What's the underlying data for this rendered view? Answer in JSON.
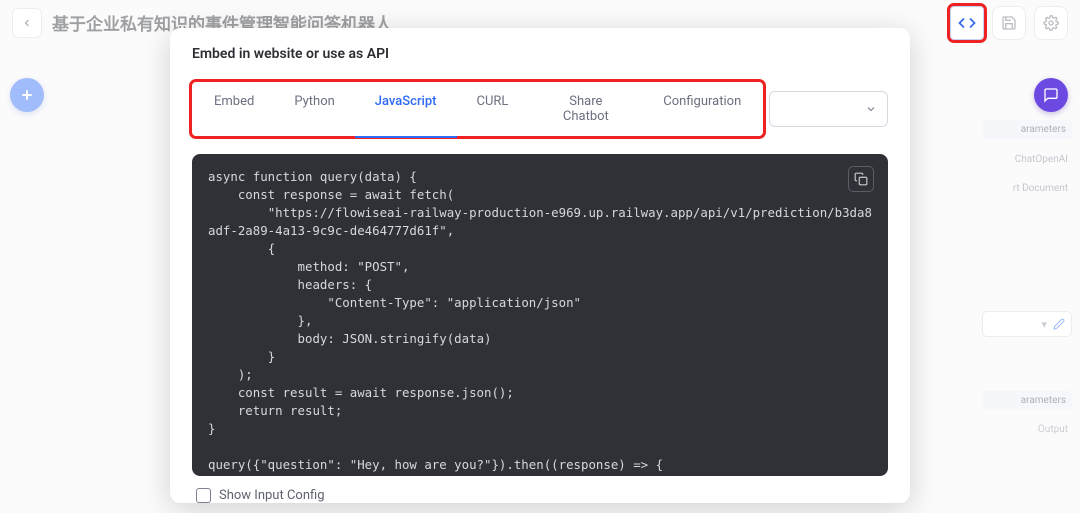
{
  "header": {
    "title": "基于企业私有知识的事件管理智能问答机器人"
  },
  "fab": {
    "plus": "+",
    "chat": "chat"
  },
  "rightcol": {
    "item1": "arameters",
    "item2": "ChatOpenAI",
    "item3": "rt Document",
    "item4_dd": "▾",
    "item5": "arameters",
    "output": "Output"
  },
  "modal": {
    "title": "Embed in website or use as API",
    "tabs": {
      "embed": "Embed",
      "python": "Python",
      "javascript": "JavaScript",
      "curl": "CURL",
      "share": "Share Chatbot",
      "config": "Configuration"
    },
    "code": "async function query(data) {\n    const response = await fetch(\n        \"https://flowiseai-railway-production-e969.up.railway.app/api/v1/prediction/b3da8adf-2a89-4a13-9c9c-de464777d61f\",\n        {\n            method: \"POST\",\n            headers: {\n                \"Content-Type\": \"application/json\"\n            },\n            body: JSON.stringify(data)\n        }\n    );\n    const result = await response.json();\n    return result;\n}\n\nquery({\"question\": \"Hey, how are you?\"}).then((response) => {\n    console.log(response);\n});",
    "show_input_config": "Show Input Config"
  }
}
